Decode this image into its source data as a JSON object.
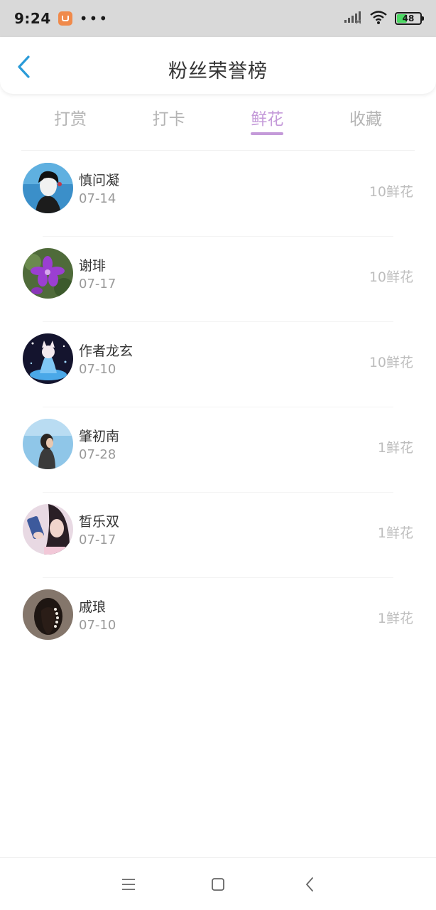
{
  "status_bar": {
    "time": "9:24",
    "dots": "•••",
    "battery_level": 48,
    "battery_text": "48",
    "icons": [
      "app-notification-icon",
      "signal-icon",
      "wifi-icon",
      "battery-icon"
    ]
  },
  "header": {
    "title": "粉丝荣誉榜",
    "back_icon": "chevron-left-icon"
  },
  "tabs": [
    {
      "label": "打赏",
      "active": false
    },
    {
      "label": "打卡",
      "active": false
    },
    {
      "label": "鲜花",
      "active": true
    },
    {
      "label": "收藏",
      "active": false
    }
  ],
  "fans": [
    {
      "name": "慎问凝",
      "date": "07-14",
      "amount": "10鲜花"
    },
    {
      "name": "谢琲",
      "date": "07-17",
      "amount": "10鲜花"
    },
    {
      "name": "作者龙玄",
      "date": "07-10",
      "amount": "10鲜花"
    },
    {
      "name": "肇初南",
      "date": "07-28",
      "amount": "1鲜花"
    },
    {
      "name": "晳乐双",
      "date": "07-17",
      "amount": "1鲜花"
    },
    {
      "name": "戚琅",
      "date": "07-10",
      "amount": "1鲜花"
    }
  ],
  "nav_bar": {
    "icons": [
      "menu-icon",
      "home-icon",
      "back-icon"
    ]
  },
  "colors": {
    "accent": "#c49ad9",
    "status_bar_bg": "#d9d9d9",
    "back_icon": "#2a9bd8",
    "battery_fill": "#4cd964"
  }
}
